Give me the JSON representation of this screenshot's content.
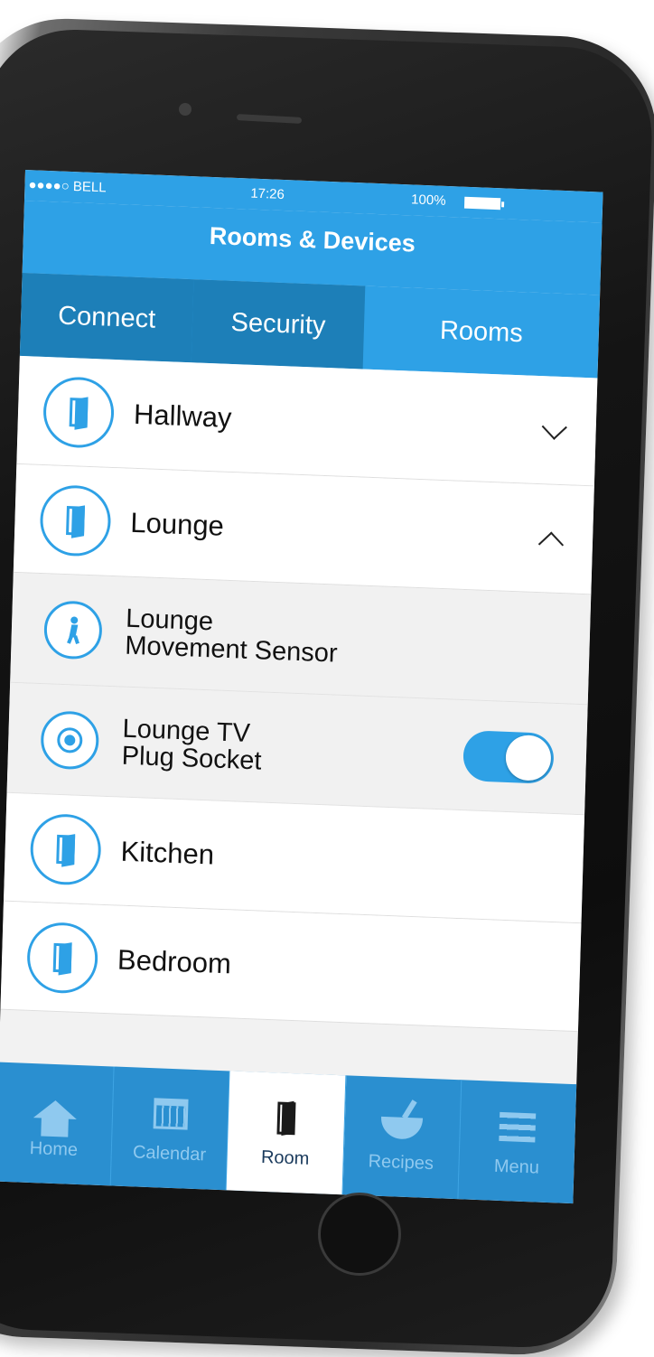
{
  "status_bar": {
    "carrier": "●●●●○ BELL",
    "time": "17:26",
    "battery": "100%"
  },
  "header": {
    "title": "Rooms & Devices"
  },
  "tabs": [
    {
      "label": "Connect",
      "active": false
    },
    {
      "label": "Security",
      "active": false
    },
    {
      "label": "Rooms",
      "active": true
    }
  ],
  "rooms_list": {
    "hallway": {
      "label": "Hallway",
      "icon": "door-icon",
      "expanded": false
    },
    "lounge": {
      "label": "Lounge",
      "icon": "door-icon",
      "expanded": true
    },
    "lounge_sensor": {
      "line1": "Lounge",
      "line2": "Movement Sensor",
      "icon": "person-walking-icon"
    },
    "lounge_plug": {
      "line1": "Lounge TV",
      "line2": "Plug Socket",
      "icon": "plug-socket-icon",
      "toggle_on": true
    },
    "kitchen": {
      "label": "Kitchen",
      "icon": "door-icon"
    },
    "bedroom": {
      "label": "Bedroom",
      "icon": "door-icon"
    }
  },
  "bottom_nav": [
    {
      "label": "Home",
      "icon": "home-icon",
      "active": false
    },
    {
      "label": "Calendar",
      "icon": "calendar-icon",
      "active": false
    },
    {
      "label": "Room",
      "icon": "door-icon",
      "active": true
    },
    {
      "label": "Recipes",
      "icon": "mortar-bowl-icon",
      "active": false
    },
    {
      "label": "Menu",
      "icon": "hamburger-menu-icon",
      "active": false
    }
  ],
  "colors": {
    "accent": "#2ea1e6",
    "tab_inactive": "#1d7fb8",
    "bottom_bar": "#2a8fd0"
  }
}
